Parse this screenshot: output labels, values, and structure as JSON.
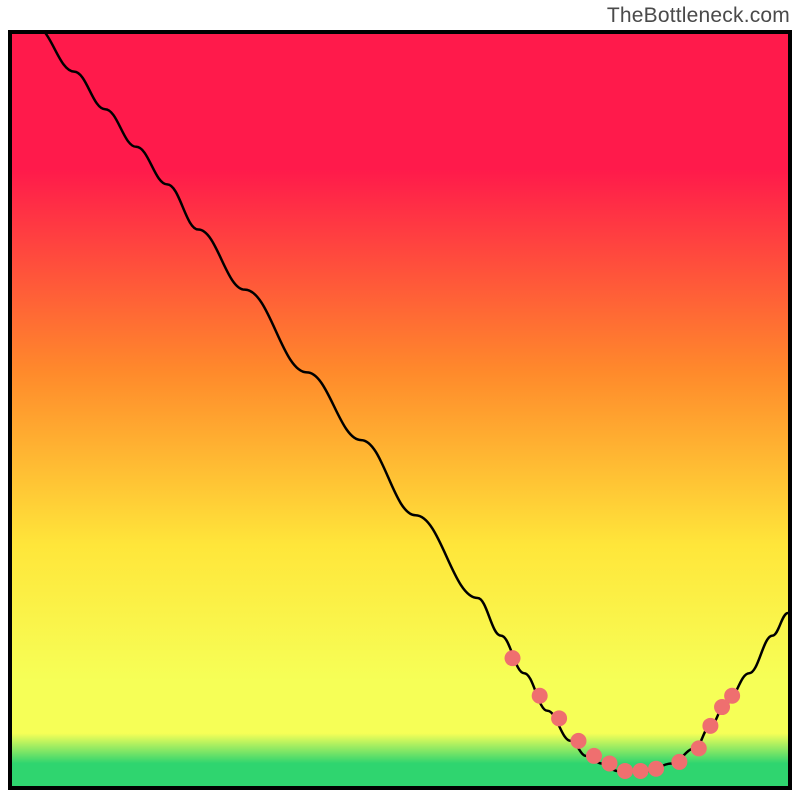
{
  "source_label": "TheBottleneck.com",
  "colors": {
    "gradient_top": "#ff1a4b",
    "gradient_mid1": "#ff8a2b",
    "gradient_mid2": "#ffe63a",
    "gradient_mid3": "#f6ff57",
    "gradient_bottom": "#2fd56f",
    "curve": "#000000",
    "dots": "#ef6f6f",
    "border": "#000000"
  },
  "chart_data": {
    "type": "line",
    "title": "",
    "xlabel": "",
    "ylabel": "",
    "xlim": [
      0,
      100
    ],
    "ylim": [
      0,
      100
    ],
    "series": [
      {
        "name": "bottleneck_curve",
        "x": [
          0,
          3,
          8,
          12,
          16,
          20,
          24,
          30,
          38,
          45,
          52,
          60,
          63,
          66,
          69,
          72,
          74,
          76,
          78,
          80,
          82,
          85,
          88,
          90,
          92,
          95,
          98,
          100
        ],
        "y": [
          109,
          101,
          95,
          90,
          85,
          80,
          74,
          66,
          55,
          46,
          36,
          25,
          20,
          15,
          10,
          6,
          4,
          3,
          2,
          2,
          2,
          3,
          5,
          8,
          11,
          15,
          20,
          23
        ]
      }
    ],
    "dot_series": {
      "name": "target_points",
      "x": [
        64.5,
        68,
        70.5,
        73,
        75,
        77,
        79,
        81,
        83,
        86,
        88.5,
        90,
        91.5,
        92.8
      ],
      "y": [
        17,
        12,
        9,
        6,
        4,
        3,
        2,
        2,
        2.3,
        3.2,
        5,
        8,
        10.5,
        12
      ]
    },
    "gradient_stops": [
      {
        "offset": 0.0,
        "colorKey": "gradient_top"
      },
      {
        "offset": 0.18,
        "colorKey": "gradient_top"
      },
      {
        "offset": 0.45,
        "colorKey": "gradient_mid1"
      },
      {
        "offset": 0.68,
        "colorKey": "gradient_mid2"
      },
      {
        "offset": 0.86,
        "colorKey": "gradient_mid3"
      },
      {
        "offset": 0.93,
        "colorKey": "gradient_mid3"
      },
      {
        "offset": 0.97,
        "colorKey": "gradient_bottom"
      },
      {
        "offset": 1.0,
        "colorKey": "gradient_bottom"
      }
    ]
  }
}
